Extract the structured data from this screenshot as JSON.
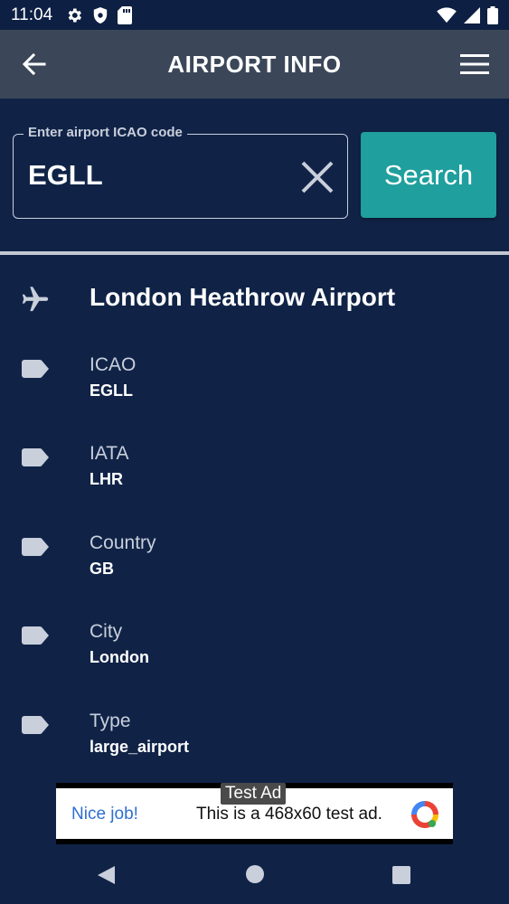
{
  "status_bar": {
    "time": "11:04",
    "left_icons": [
      "gear-icon",
      "shield-icon",
      "sd-card-icon"
    ],
    "right_icons": [
      "wifi-icon",
      "signal-icon",
      "battery-icon"
    ]
  },
  "app_bar": {
    "title": "AIRPORT INFO",
    "back_icon": "arrow-left-icon",
    "menu_icon": "hamburger-menu-icon"
  },
  "search": {
    "label": "Enter airport ICAO code",
    "value": "EGLL",
    "clear_icon": "close-icon",
    "button_label": "Search"
  },
  "airport": {
    "name": "London Heathrow Airport",
    "icon": "airplane-icon",
    "fields": [
      {
        "label": "ICAO",
        "value": "EGLL",
        "icon": "tag-icon"
      },
      {
        "label": "IATA",
        "value": "LHR",
        "icon": "tag-icon"
      },
      {
        "label": "Country",
        "value": "GB",
        "icon": "tag-icon"
      },
      {
        "label": "City",
        "value": "London",
        "icon": "tag-icon"
      },
      {
        "label": "Type",
        "value": "large_airport",
        "icon": "tag-icon"
      }
    ]
  },
  "ad": {
    "tag": "Test Ad",
    "headline": "Nice job!",
    "body": "This is a 468x60 test ad."
  },
  "colors": {
    "background": "#102347",
    "app_bar": "#3b4758",
    "accent": "#1f9f9d",
    "label": "#c9cfdb"
  }
}
